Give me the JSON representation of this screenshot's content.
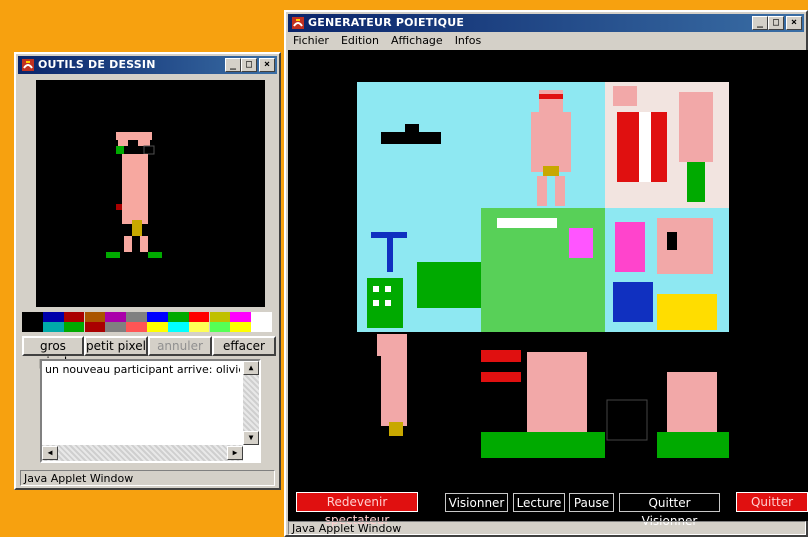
{
  "tools_window": {
    "title": "OUTILS DE DESSIN",
    "buttons": {
      "gros_pixel": "gros pixel",
      "petit_pixel": "petit pixel",
      "annuler": "annuler",
      "effacer": "effacer"
    },
    "chat_message": "un nouveau participant arrive: olivier@",
    "status": "Java Applet Window",
    "palette_top": [
      "#000000",
      "#0000aa",
      "#aa0000",
      "#aa5500",
      "#aa00aa",
      "#808080",
      "#0000ff",
      "#00aa00",
      "#ff0000",
      "#c0c000",
      "#ff00ff",
      "#ffffff"
    ],
    "palette_bottom": [
      "#000000",
      "#00aaaa",
      "#00aa00",
      "#aa0000",
      "#808080",
      "#ff5555",
      "#ffff00",
      "#00ffff",
      "#ffff55",
      "#55ff55",
      "#ffff00",
      "#ffffff"
    ]
  },
  "generator_window": {
    "title": "GENERATEUR POIETIQUE",
    "menu": [
      "Fichier",
      "Edition",
      "Affichage",
      "Infos"
    ],
    "buttons": {
      "redevenir": "Redevenir spectateur",
      "visionner": "Visionner",
      "lecture": "Lecture",
      "pause": "Pause",
      "quitter_visionner": "Quitter Visionner",
      "quitter": "Quitter"
    },
    "status": "Java Applet Window"
  },
  "colors": {
    "background": "#f7a10f",
    "title_start": "#0a246a",
    "title_end": "#3a6ea5",
    "button_red": "#e01010"
  }
}
